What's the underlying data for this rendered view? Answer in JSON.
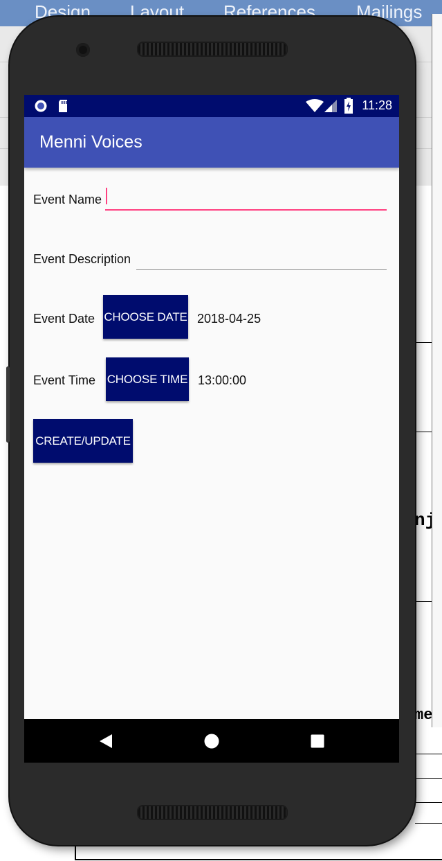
{
  "background_app": {
    "ribbon_tabs": [
      "Design",
      "Layout",
      "References",
      "Mailings"
    ],
    "doc_fragments": [
      "nj",
      "me"
    ]
  },
  "status_bar": {
    "time": "11:28",
    "icons": [
      "notification-dot-icon",
      "sd-card-icon",
      "wifi-icon",
      "signal-icon",
      "battery-charging-icon"
    ]
  },
  "app_bar": {
    "title": "Menni Voices"
  },
  "form": {
    "event_name": {
      "label": "Event Name",
      "value": ""
    },
    "event_description": {
      "label": "Event Description",
      "value": ""
    },
    "event_date": {
      "label": "Event Date",
      "button": "CHOOSE DATE",
      "value": "2018-04-25"
    },
    "event_time": {
      "label": "Event Time",
      "button": "CHOOSE TIME",
      "value": "13:00:00"
    },
    "submit_button": "CREATE/UPDATE"
  },
  "colors": {
    "status_bar": "#000c6e",
    "app_bar": "#3f51b5",
    "button": "#000c6e",
    "accent_focus": "#ff4081"
  },
  "nav_bar": {
    "icons": [
      "back-icon",
      "home-icon",
      "recents-icon"
    ]
  }
}
